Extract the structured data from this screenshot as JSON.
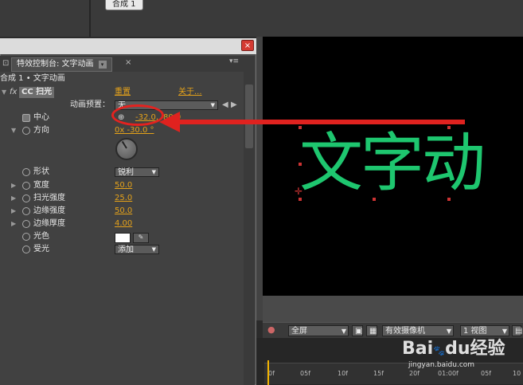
{
  "top": {
    "comp_tab": "合成 1"
  },
  "panel": {
    "tab_title": "特效控制台: 文字动画",
    "tab_menu": "▾",
    "panel_menu": "▾≡",
    "breadcrumb": "合成 1 • 文字动画",
    "close": "×",
    "effect": {
      "fx_label": "fx",
      "name": "CC 扫光",
      "reset": "重置",
      "about": "关于..."
    },
    "preset": {
      "label": "动画预置：",
      "value": "无"
    },
    "properties": [
      {
        "id": "center",
        "label": "中心",
        "value1": "-32.0,",
        "value2": "80.0"
      },
      {
        "id": "direction",
        "label": "方向",
        "value": "0x -30.0 °"
      },
      {
        "id": "shape",
        "label": "形状",
        "dropdown": "锐利"
      },
      {
        "id": "width",
        "label": "宽度",
        "value": "50.0"
      },
      {
        "id": "sweep_intensity",
        "label": "扫光强度",
        "value": "25.0"
      },
      {
        "id": "edge_intensity",
        "label": "边缘强度",
        "value": "50.0"
      },
      {
        "id": "edge_thickness",
        "label": "边缘厚度",
        "value": "4.00"
      },
      {
        "id": "light_color",
        "label": "光色"
      },
      {
        "id": "light_reception",
        "label": "受光",
        "dropdown": "添加"
      }
    ]
  },
  "viewer": {
    "text": "文字动",
    "zoom": "全屏",
    "camera": "有效摄像机",
    "views": "1 视图"
  },
  "timeline": {
    "ticks": [
      "0f",
      "05f",
      "10f",
      "15f",
      "20f",
      "01:00f",
      "05f",
      "10"
    ]
  },
  "watermark": {
    "brand": "Bai",
    "paw": "du",
    "brand2": "经验",
    "url": "jingyan.baidu.com"
  },
  "colors": {
    "accent_value": "#e5a21a",
    "viewer_text": "#1ec66f",
    "annotation": "#e0221f"
  }
}
